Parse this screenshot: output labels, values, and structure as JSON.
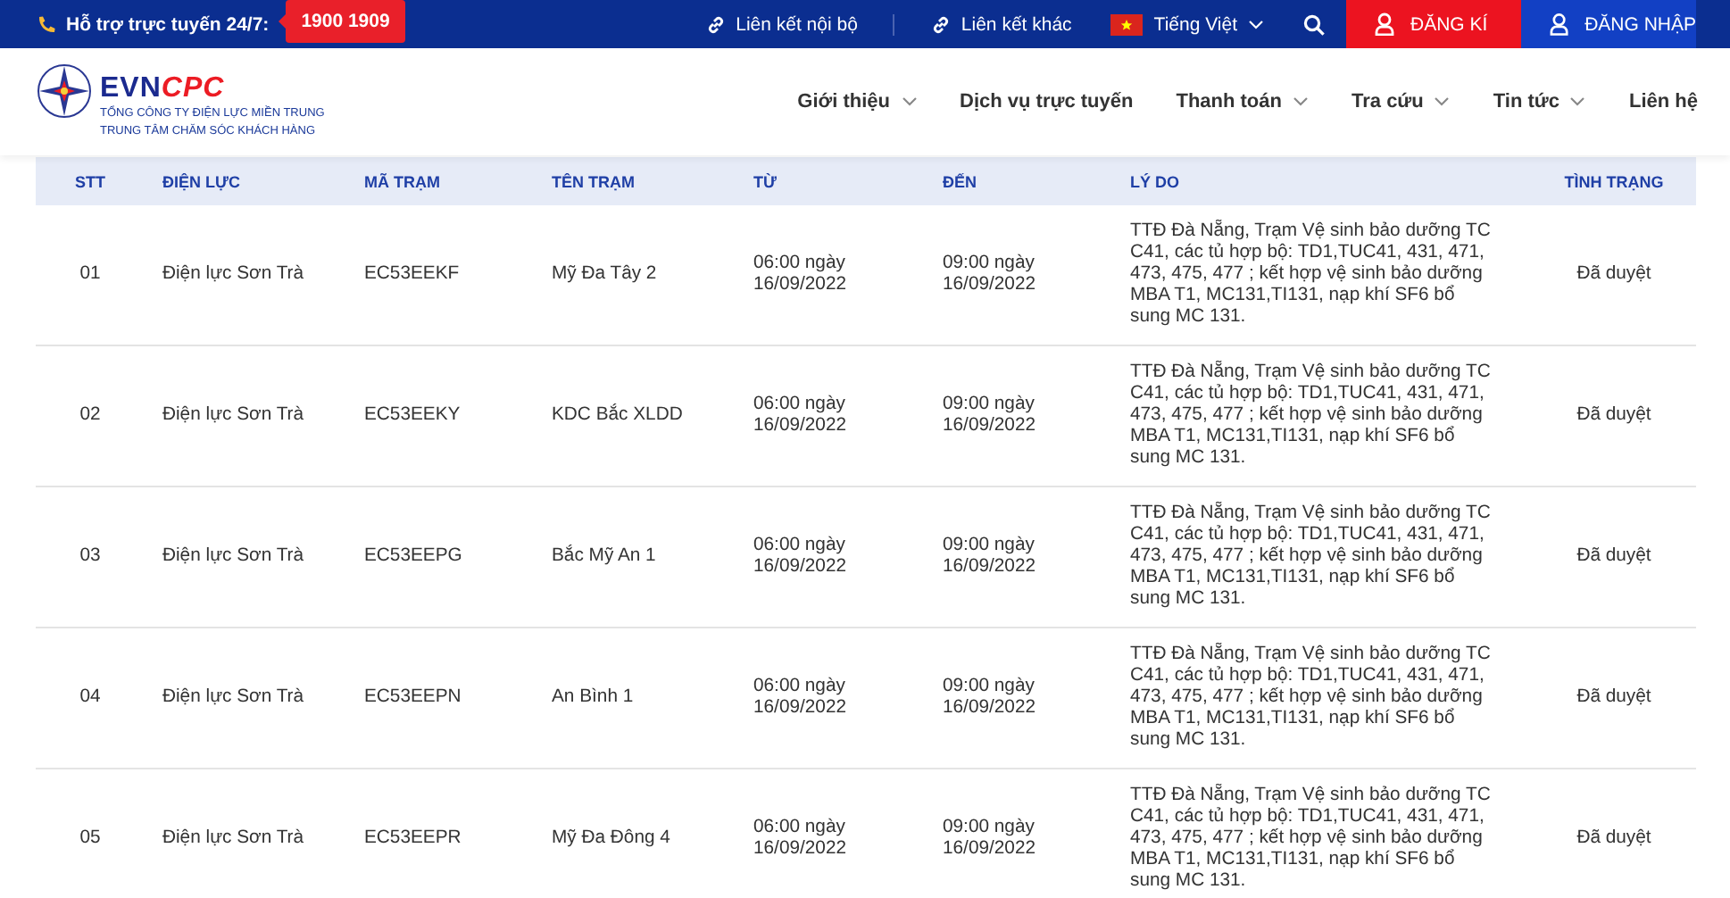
{
  "top_bar": {
    "hotline_label": "Hỗ trợ trực tuyến 24/7:",
    "hotline_number": "1900 1909",
    "links": [
      "Liên kết nội bộ",
      "Liên kết khác"
    ],
    "language": "Tiếng Việt",
    "register": "ĐĂNG KÍ",
    "login": "ĐĂNG NHẬP"
  },
  "header": {
    "logo": {
      "brand_main": "EVN",
      "brand_accent": "CPC",
      "line_1": "TỔNG CÔNG TY ĐIỆN LỰC MIỀN TRUNG",
      "line_2": "TRUNG TÂM CHĂM SÓC KHÁCH HÀNG"
    },
    "nav": [
      {
        "label": "Giới thiệu",
        "has_dropdown": true
      },
      {
        "label": "Dịch vụ trực tuyến",
        "has_dropdown": false
      },
      {
        "label": "Thanh toán",
        "has_dropdown": true
      },
      {
        "label": "Tra cứu",
        "has_dropdown": true
      },
      {
        "label": "Tin tức",
        "has_dropdown": true
      },
      {
        "label": "Liên hệ",
        "has_dropdown": false
      }
    ]
  },
  "table": {
    "columns": [
      "STT",
      "ĐIỆN LỰC",
      "MÃ TRẠM",
      "TÊN TRẠM",
      "TỪ",
      "ĐẾN",
      "LÝ DO",
      "TÌNH TRẠNG"
    ],
    "rows": [
      [
        "01",
        "Điện lực Sơn Trà",
        "EC53EEKF",
        "Mỹ Đa Tây 2",
        "06:00 ngày 16/09/2022",
        "09:00 ngày 16/09/2022",
        "TTĐ Đà Nẵng, Trạm Vệ sinh bảo dưỡng TC C41, các tủ hợp bộ: TD1,TUC41, 431, 471, 473, 475, 477 ; kết hợp vệ sinh bảo dưỡng MBA T1, MC131,TI131, nạp khí SF6 bổ sung MC 131.",
        "Đã duyệt"
      ],
      [
        "02",
        "Điện lực Sơn Trà",
        "EC53EEKY",
        "KDC Bắc XLDD",
        "06:00 ngày 16/09/2022",
        "09:00 ngày 16/09/2022",
        "TTĐ Đà Nẵng, Trạm Vệ sinh bảo dưỡng TC C41, các tủ hợp bộ: TD1,TUC41, 431, 471, 473, 475, 477 ; kết hợp vệ sinh bảo dưỡng MBA T1, MC131,TI131, nạp khí SF6 bổ sung MC 131.",
        "Đã duyệt"
      ],
      [
        "03",
        "Điện lực Sơn Trà",
        "EC53EEPG",
        "Bắc Mỹ An 1",
        "06:00 ngày 16/09/2022",
        "09:00 ngày 16/09/2022",
        "TTĐ Đà Nẵng, Trạm Vệ sinh bảo dưỡng TC C41, các tủ hợp bộ: TD1,TUC41, 431, 471, 473, 475, 477 ; kết hợp vệ sinh bảo dưỡng MBA T1, MC131,TI131, nạp khí SF6 bổ sung MC 131.",
        "Đã duyệt"
      ],
      [
        "04",
        "Điện lực Sơn Trà",
        "EC53EEPN",
        "An Bình 1",
        "06:00 ngày 16/09/2022",
        "09:00 ngày 16/09/2022",
        "TTĐ Đà Nẵng, Trạm Vệ sinh bảo dưỡng TC C41, các tủ hợp bộ: TD1,TUC41, 431, 471, 473, 475, 477 ; kết hợp vệ sinh bảo dưỡng MBA T1, MC131,TI131, nạp khí SF6 bổ sung MC 131.",
        "Đã duyệt"
      ],
      [
        "05",
        "Điện lực Sơn Trà",
        "EC53EEPR",
        "Mỹ Đa Đông 4",
        "06:00 ngày 16/09/2022",
        "09:00 ngày 16/09/2022",
        "TTĐ Đà Nẵng, Trạm Vệ sinh bảo dưỡng TC C41, các tủ hợp bộ: TD1,TUC41, 431, 471, 473, 475, 477 ; kết hợp vệ sinh bảo dưỡng MBA T1, MC131,TI131, nạp khí SF6 bổ sung MC 131.",
        "Đã duyệt"
      ]
    ]
  }
}
